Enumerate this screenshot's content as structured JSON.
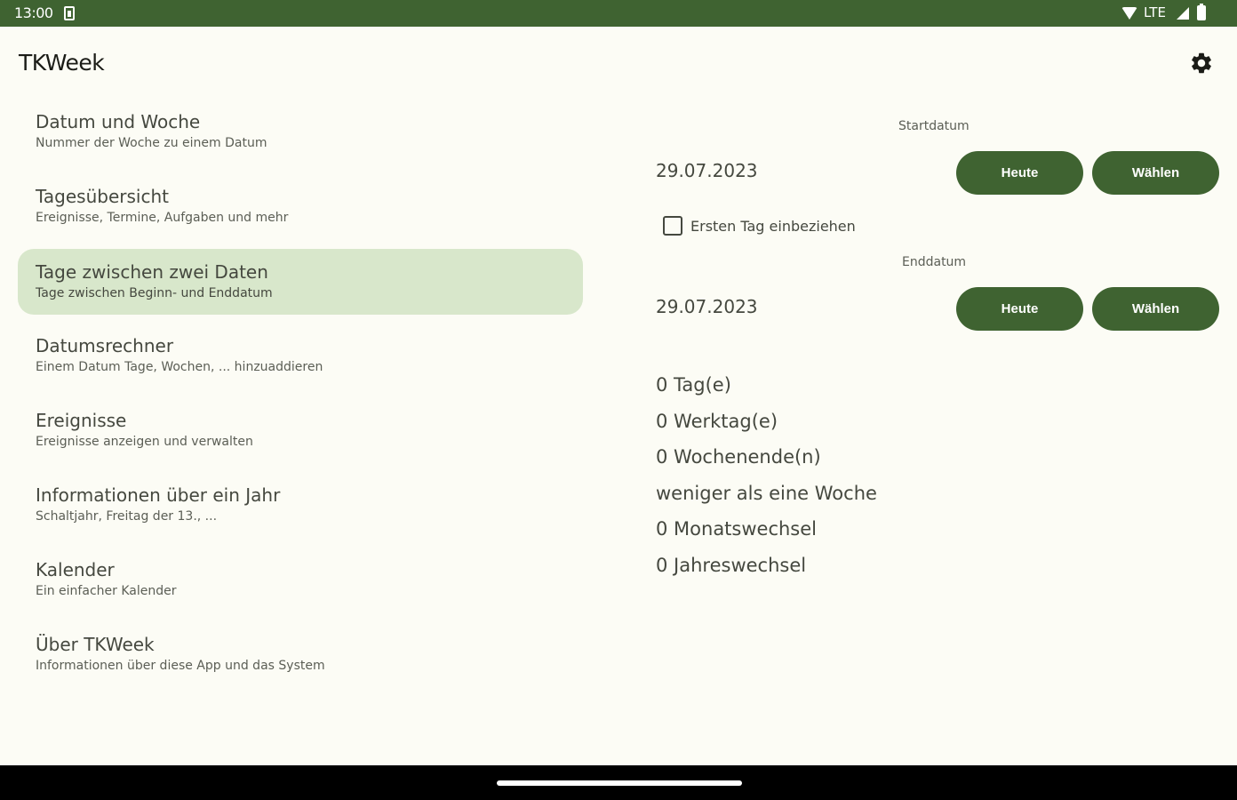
{
  "status_bar": {
    "time": "13:00",
    "network": "LTE",
    "icons": [
      "sim-card-icon",
      "wifi-icon",
      "signal-icon",
      "battery-icon"
    ]
  },
  "app": {
    "title": "TKWeek",
    "settings_icon": "gear-icon"
  },
  "nav": {
    "items": [
      {
        "title": "Datum und Woche",
        "subtitle": "Nummer der Woche zu einem Datum"
      },
      {
        "title": "Tagesübersicht",
        "subtitle": "Ereignisse, Termine, Aufgaben und mehr"
      },
      {
        "title": "Tage zwischen zwei Daten",
        "subtitle": "Tage zwischen Beginn- und Enddatum",
        "selected": true
      },
      {
        "title": "Datumsrechner",
        "subtitle": "Einem Datum Tage, Wochen, ... hinzuaddieren"
      },
      {
        "title": "Ereignisse",
        "subtitle": "Ereignisse anzeigen und verwalten"
      },
      {
        "title": "Informationen über ein Jahr",
        "subtitle": "Schaltjahr, Freitag der 13., ..."
      },
      {
        "title": "Kalender",
        "subtitle": "Ein einfacher Kalender"
      },
      {
        "title": "Über TKWeek",
        "subtitle": "Informationen über diese App und das System"
      }
    ]
  },
  "detail": {
    "start": {
      "label": "Startdatum",
      "date": "29.07.2023",
      "today_button": "Heute",
      "choose_button": "Wählen"
    },
    "include_first_day": {
      "label": "Ersten Tag einbeziehen",
      "checked": false
    },
    "end": {
      "label": "Enddatum",
      "date": "29.07.2023",
      "today_button": "Heute",
      "choose_button": "Wählen"
    },
    "results": [
      "0 Tag(e)",
      "0 Werktag(e)",
      "0 Wochenende(n)",
      "weniger als eine Woche",
      "0 Monatswechsel",
      "0 Jahreswechsel"
    ]
  },
  "colors": {
    "primary": "#3f6331",
    "selected_background": "#d8e7cb",
    "background": "#fcfcf5",
    "text": "#45483f"
  }
}
